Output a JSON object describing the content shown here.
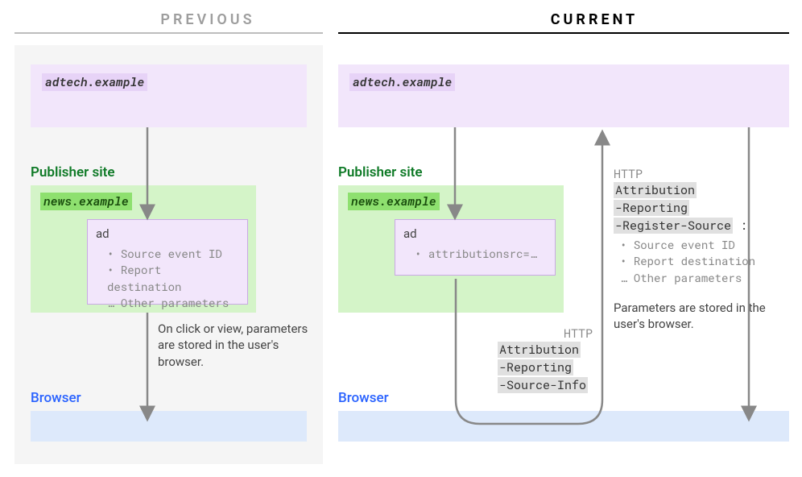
{
  "titles": {
    "previous": "PREVIOUS",
    "current": "CURRENT"
  },
  "adtech": {
    "label": "adtech.example"
  },
  "publisher": {
    "label": "Publisher site",
    "news_label": "news.example",
    "ad_title": "ad"
  },
  "previous": {
    "ad_params": {
      "p1": "Source event ID",
      "p2": "Report destination",
      "p3": "Other parameters"
    },
    "note": "On click or view, parameters are stored in the user's browser."
  },
  "current": {
    "ad_param": "attributionsrc=…",
    "http_label": "HTTP",
    "req_header": {
      "l1": "Attribution",
      "l2": "-Reporting",
      "l3": "-Source-Info"
    },
    "resp_header": {
      "l1": "Attribution",
      "l2": "-Reporting",
      "l3": "-Register-Source",
      "colon": ":"
    },
    "resp_params": {
      "p1": "Source event ID",
      "p2": "Report destination",
      "p3": "Other parameters"
    },
    "note": "Parameters are stored in the user's browser."
  },
  "browser": {
    "label": "Browser"
  }
}
